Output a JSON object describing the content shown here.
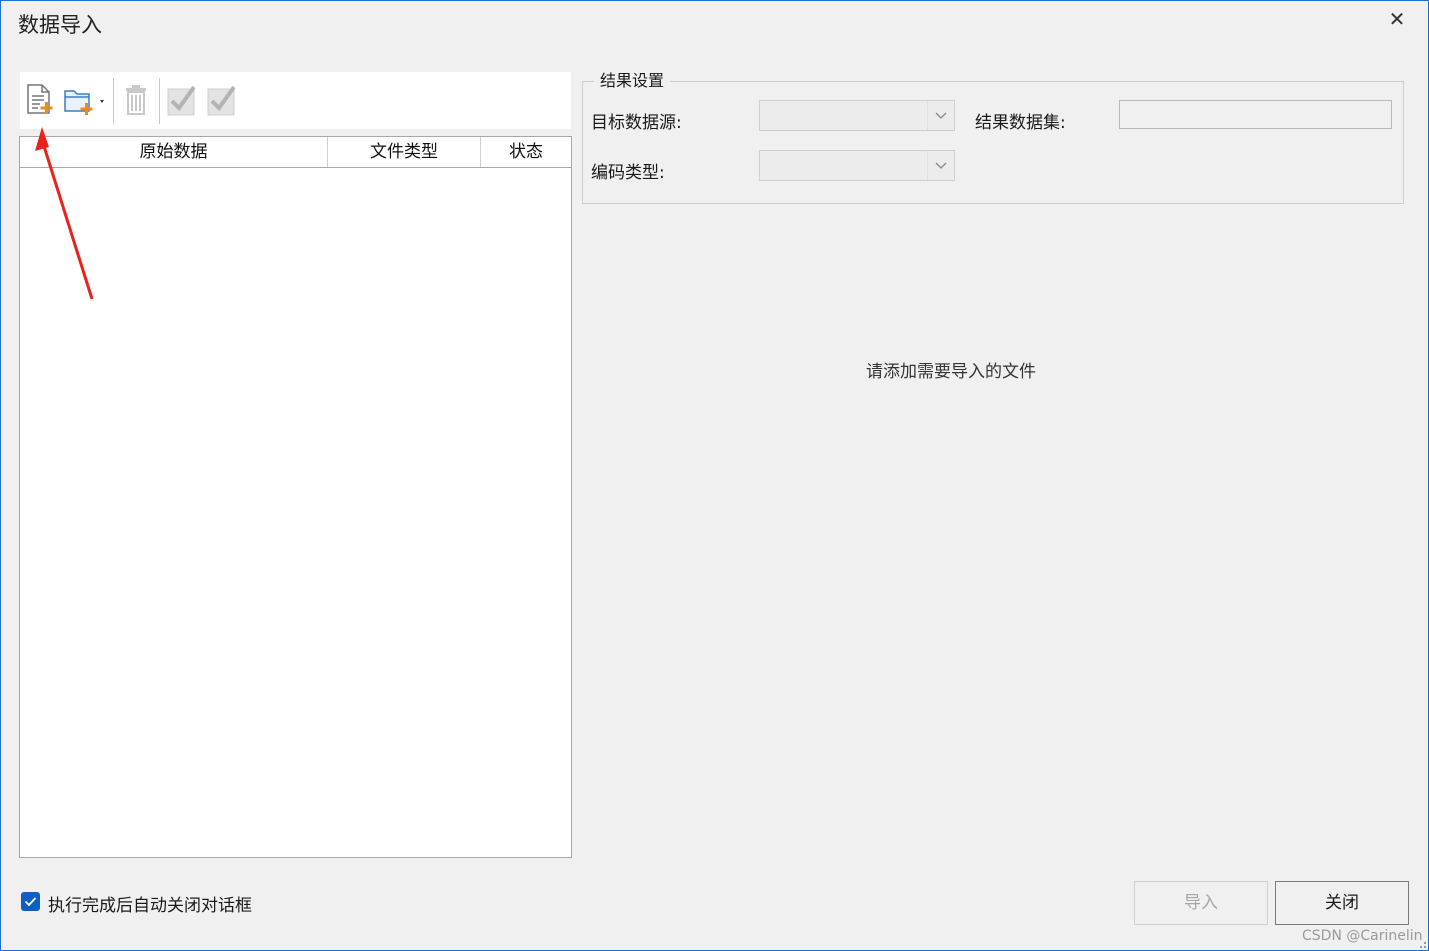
{
  "window": {
    "title": "数据导入",
    "close_icon": "close-icon"
  },
  "toolbar": {
    "buttons": [
      {
        "name": "add-file",
        "icon": "file-add-icon",
        "enabled": true
      },
      {
        "name": "add-folder",
        "icon": "folder-add-icon",
        "enabled": true,
        "has_dropdown": true
      },
      {
        "name": "delete",
        "icon": "trash-icon",
        "enabled": false
      },
      {
        "name": "select-all",
        "icon": "check-icon",
        "enabled": false
      },
      {
        "name": "invert-select",
        "icon": "check-icon",
        "enabled": false
      }
    ]
  },
  "file_list": {
    "columns": [
      "原始数据",
      "文件类型",
      "状态"
    ],
    "rows": []
  },
  "result_settings": {
    "group_title": "结果设置",
    "target_datasource_label": "目标数据源:",
    "target_datasource_value": "",
    "result_dataset_label": "结果数据集:",
    "result_dataset_value": "",
    "encoding_label": "编码类型:",
    "encoding_value": ""
  },
  "main": {
    "empty_hint": "请添加需要导入的文件"
  },
  "footer": {
    "auto_close_label": "执行完成后自动关闭对话框",
    "auto_close_checked": true,
    "import_label": "导入",
    "close_label": "关闭"
  },
  "watermark": "CSDN @Carinelin",
  "annotation": {
    "arrow_color": "#e8231c"
  }
}
